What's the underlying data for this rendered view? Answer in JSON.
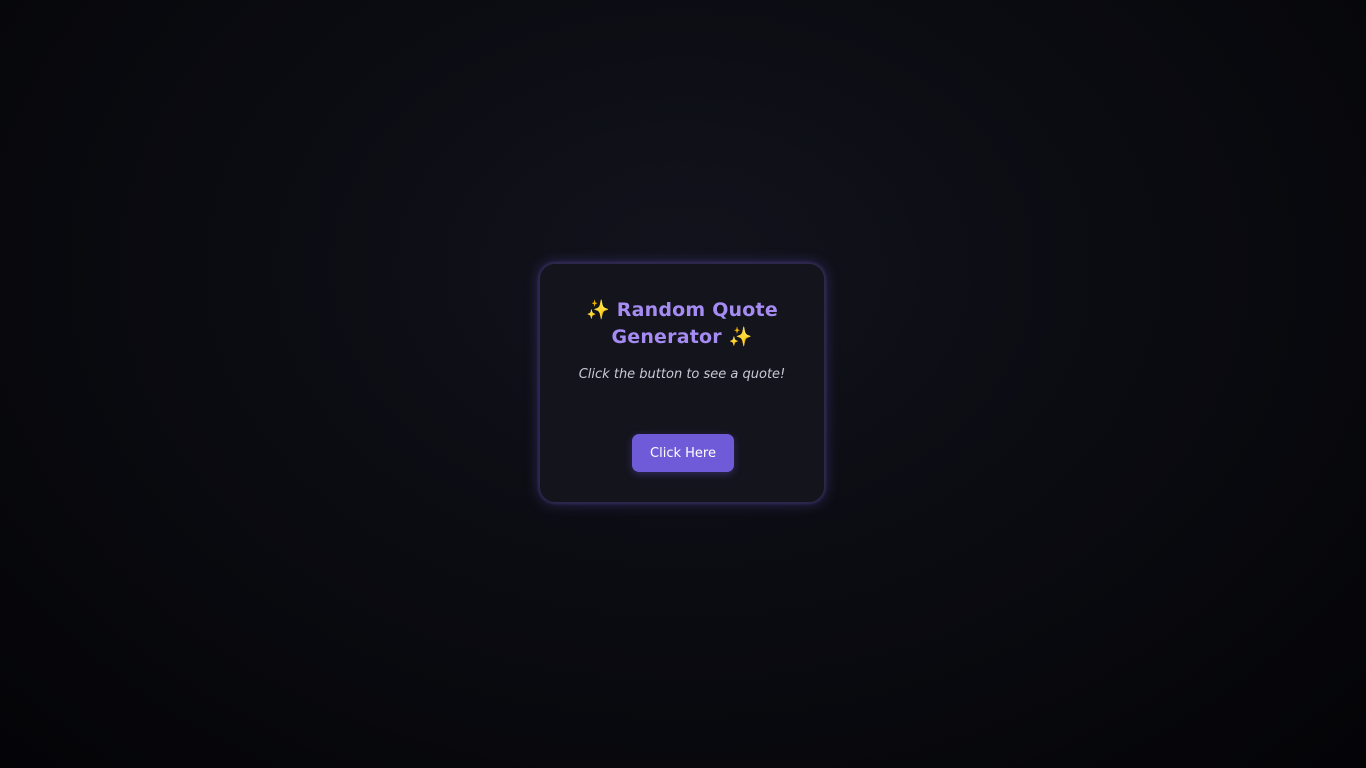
{
  "card": {
    "title_prefix_icon": "✨",
    "title_text": "Random Quote Generator",
    "title_suffix_icon": "✨",
    "subtitle": "Click the button to see a quote!",
    "button_label": "Click Here"
  },
  "colors": {
    "accent": "#6f5bd8",
    "title": "#a58bf2",
    "sparkle": "#f2c14e",
    "card_background": "#14141d",
    "page_background": "#0b0c12"
  }
}
